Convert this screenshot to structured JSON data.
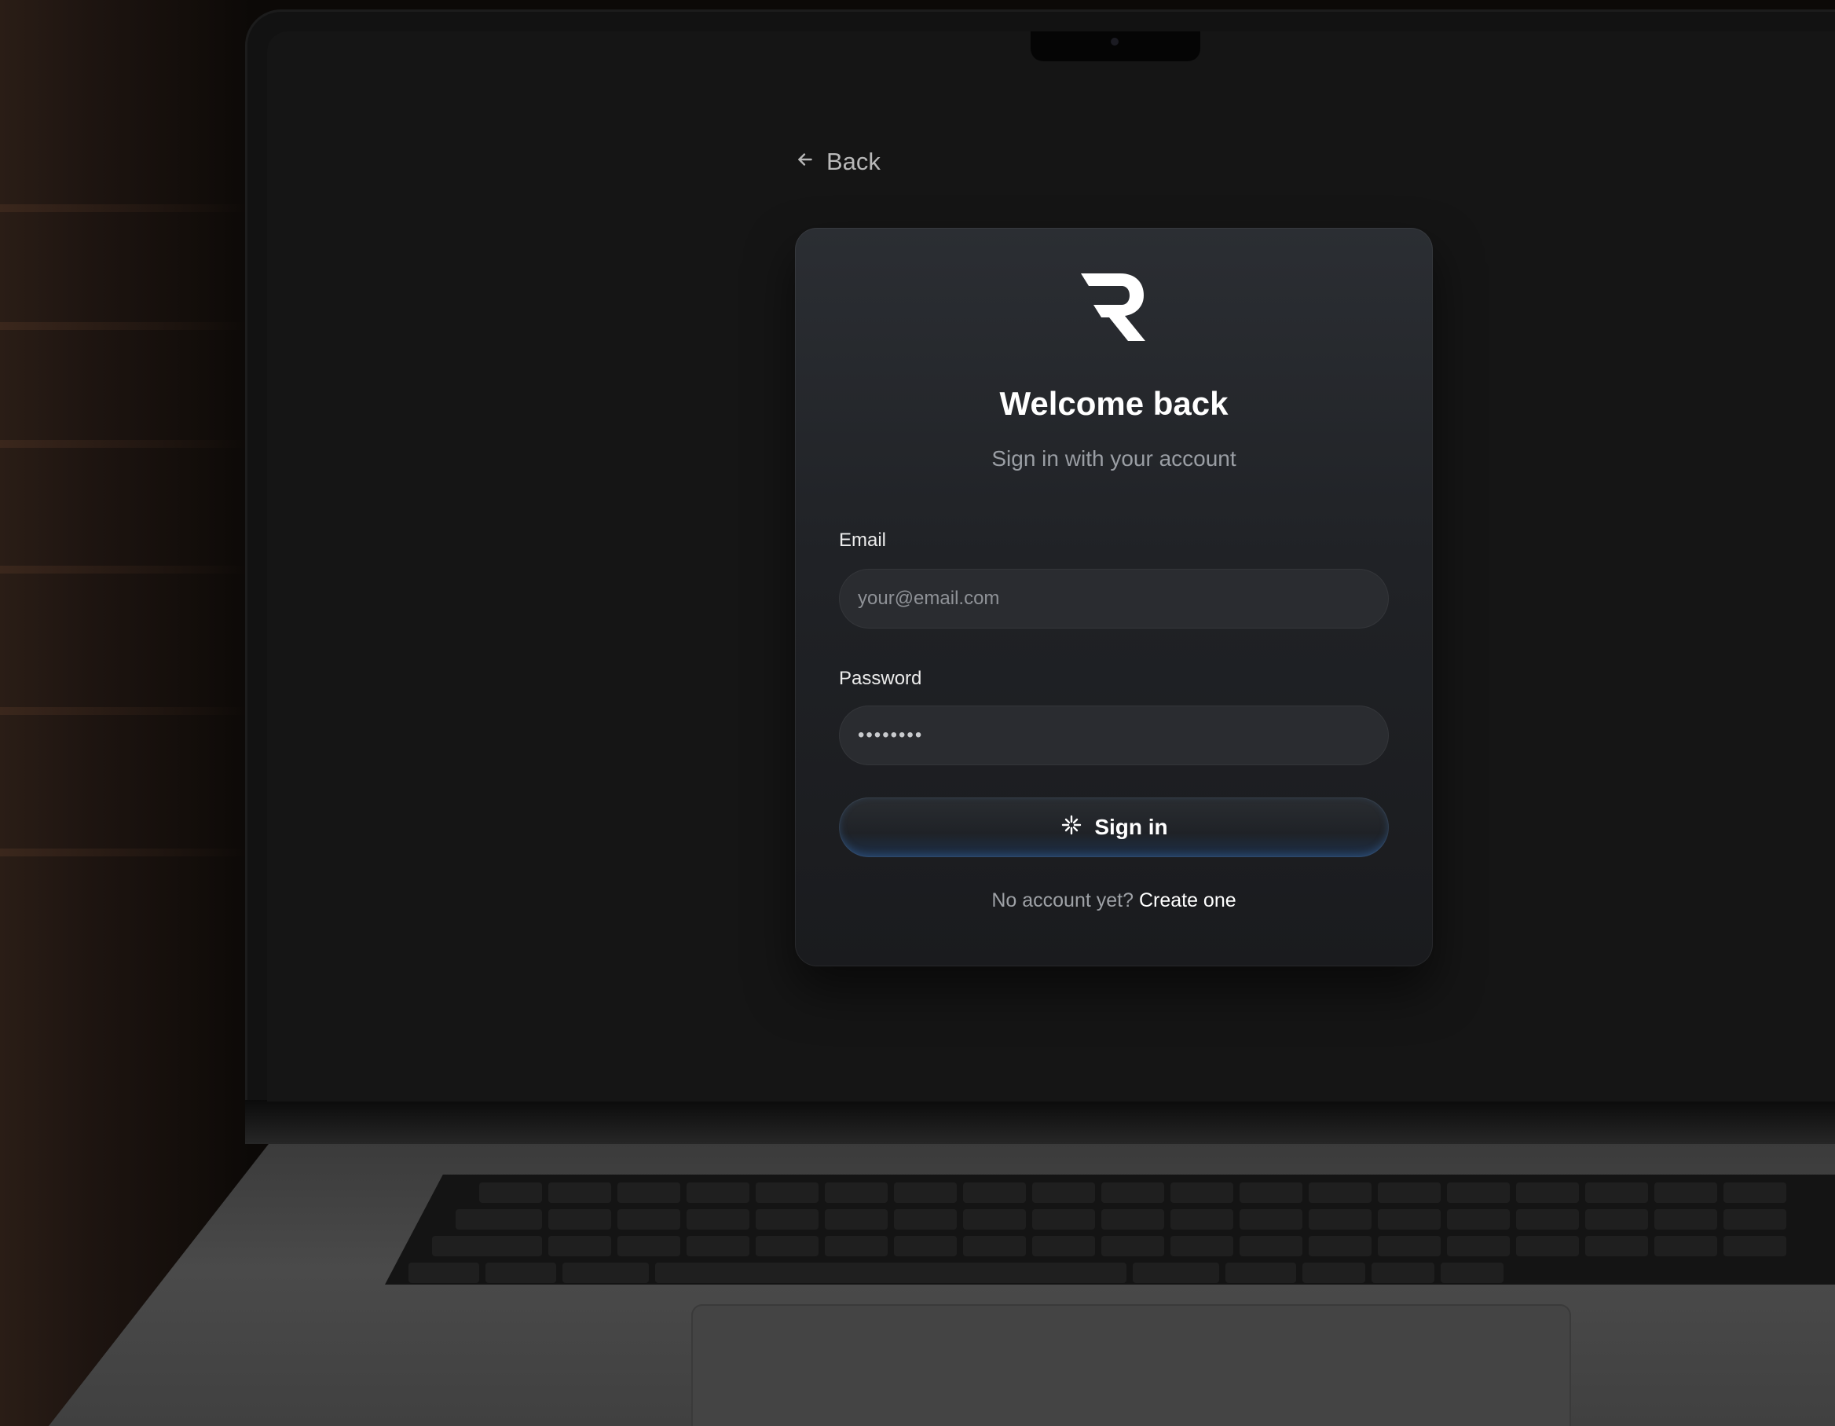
{
  "nav": {
    "back_label": "Back"
  },
  "login_card": {
    "logo_icon": "r-logo-icon",
    "title": "Welcome back",
    "subtitle": "Sign in with your account",
    "email": {
      "label": "Email",
      "placeholder": "your@email.com",
      "value": ""
    },
    "password": {
      "label": "Password",
      "value": "••••••••"
    },
    "sign_in_button": {
      "label": "Sign in",
      "icon": "sparkle-icon"
    },
    "footer": {
      "prompt": "No account yet?",
      "link_label": "Create one"
    }
  },
  "colors": {
    "background": "#151515",
    "card": "#222428",
    "accent_glow": "#3c6eaa",
    "text_primary": "#ffffff",
    "text_muted": "#9a9ea4"
  }
}
